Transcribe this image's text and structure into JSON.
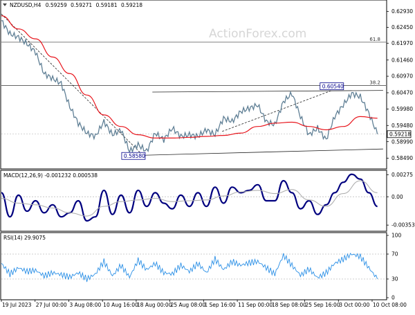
{
  "header": {
    "symbol": "NZDUSD,H4",
    "open": "0.59259",
    "high": "0.59271",
    "low": "0.59181",
    "close": "0.59218"
  },
  "watermark": "ActionForex.com",
  "colors": {
    "price": "#5f7f95",
    "ma": "#e8151c",
    "macd": "#00007f",
    "signal": "#b0b0b0",
    "rsi": "#2a8fe6",
    "level_dotted": "#c0c0c0",
    "label_border": "#00008b"
  },
  "chart_data": [
    {
      "type": "line",
      "panel": "price",
      "title": "NZDUSD,H4",
      "y_ticks": [
        "0.62930",
        "0.62450",
        "0.61970",
        "0.61460",
        "0.60970",
        "0.60470",
        "0.59980",
        "0.59480",
        "0.58990",
        "0.58490"
      ],
      "ylim": [
        0.5825,
        0.6315
      ],
      "x_labels": [
        "19 Jul 2023",
        "27 Jul 00:00",
        "3 Aug 08:00",
        "10 Aug 16:00",
        "18 Aug 00:00",
        "25 Aug 08:00",
        "1 Sep 16:00",
        "11 Sep 00:00",
        "18 Sep 08:00",
        "25 Sep 16:00",
        "3 Oct 00:00",
        "10 Oct 08:00"
      ],
      "series": [
        {
          "name": "",
          "x": [
            0,
            6,
            12,
            18,
            24,
            30,
            36,
            42,
            48,
            54,
            60,
            66,
            72,
            78,
            84,
            90,
            96,
            102,
            108,
            114,
            120,
            126,
            132,
            138,
            144,
            150,
            156,
            162,
            168,
            174,
            180,
            186,
            192,
            198,
            204,
            210,
            216,
            222,
            228,
            234,
            240,
            246,
            252,
            258,
            264
          ],
          "values": [
            0.6265,
            0.6225,
            0.6215,
            0.6195,
            0.617,
            0.6105,
            0.609,
            0.6075,
            0.6005,
            0.5955,
            0.5925,
            0.5915,
            0.596,
            0.592,
            0.5935,
            0.587,
            0.589,
            0.587,
            0.5925,
            0.5905,
            0.594,
            0.5915,
            0.592,
            0.5915,
            0.5935,
            0.592,
            0.597,
            0.596,
            0.599,
            0.6,
            0.601,
            0.596,
            0.595,
            0.602,
            0.6045,
            0.5975,
            0.592,
            0.594,
            0.5905,
            0.5975,
            0.601,
            0.6045,
            0.6035,
            0.5985,
            0.5922
          ]
        },
        {
          "name": "",
          "x": [
            0,
            12,
            24,
            36,
            48,
            60,
            72,
            84,
            96,
            108,
            120,
            132,
            144,
            156,
            168,
            180,
            192,
            204,
            216,
            228,
            240,
            252,
            264
          ],
          "values": [
            0.628,
            0.624,
            0.621,
            0.6155,
            0.6105,
            0.604,
            0.598,
            0.5945,
            0.592,
            0.591,
            0.591,
            0.5912,
            0.5915,
            0.5918,
            0.5925,
            0.5945,
            0.5955,
            0.5958,
            0.5945,
            0.5935,
            0.5945,
            0.5975,
            0.597
          ]
        }
      ],
      "levels": [
        {
          "label": "61.8",
          "value": 0.62
        },
        {
          "label": "38.2",
          "value": 0.6069
        },
        {
          "label": "",
          "value": 0.5922
        }
      ],
      "trendlines": [
        {
          "x": [
            0,
            100
          ],
          "values": [
            0.6285,
            0.5855
          ]
        },
        {
          "x": [
            106,
            268
          ],
          "values": [
            0.6049,
            0.6054
          ]
        },
        {
          "x": [
            100,
            268
          ],
          "values": [
            0.5858,
            0.5877
          ]
        },
        {
          "x": [
            155,
            232
          ],
          "values": [
            0.593,
            0.6054
          ]
        }
      ],
      "annotations": [
        {
          "text": "0.60540",
          "x": 232,
          "value": 0.6054
        },
        {
          "text": "0.58580",
          "x": 100,
          "value": 0.5858
        },
        {
          "text": "0.59218",
          "x": 268,
          "value": 0.59218
        }
      ]
    },
    {
      "type": "line",
      "panel": "macd",
      "title": "MACD(12,26,9) -0.001232 0.000538",
      "y_ticks": [
        "0.00275",
        "0.00",
        "-0.003531"
      ],
      "ylim": [
        -0.00395,
        0.00295
      ],
      "series": [
        {
          "name": "",
          "x": [
            0,
            6,
            12,
            18,
            24,
            30,
            36,
            42,
            48,
            54,
            60,
            66,
            72,
            78,
            84,
            90,
            96,
            102,
            108,
            114,
            120,
            126,
            132,
            138,
            144,
            150,
            156,
            162,
            168,
            174,
            180,
            186,
            192,
            198,
            204,
            210,
            216,
            222,
            228,
            234,
            240,
            246,
            252,
            258,
            264
          ],
          "values": [
            0.0005,
            -0.0025,
            0.0002,
            -0.0018,
            -0.0005,
            -0.002,
            -0.001,
            -0.0025,
            -0.002,
            -0.0005,
            -0.003,
            -0.0025,
            0.0008,
            -0.0022,
            0.0002,
            -0.002,
            0.0008,
            -0.0012,
            0.0005,
            -0.0008,
            -0.0015,
            0.0002,
            -0.0012,
            0.0005,
            -0.0012,
            0.0012,
            -0.0008,
            0.0012,
            0.0005,
            0.0008,
            0.0015,
            -0.0005,
            -0.0005,
            0.002,
            0.0005,
            -0.0015,
            -0.0005,
            -0.0022,
            -0.001,
            0.0005,
            0.0018,
            0.0028,
            0.0022,
            0.0005,
            -0.0012
          ]
        },
        {
          "name": "",
          "x": [
            0,
            12,
            24,
            36,
            48,
            60,
            72,
            84,
            96,
            108,
            120,
            132,
            144,
            156,
            168,
            180,
            192,
            204,
            216,
            228,
            240,
            252,
            264
          ],
          "values": [
            -0.0002,
            -0.0008,
            -0.001,
            -0.0014,
            -0.002,
            -0.0024,
            -0.0012,
            -0.0006,
            -0.0004,
            -0.0002,
            -0.0006,
            -0.0005,
            -0.0004,
            0.0001,
            0.0006,
            0.0008,
            0.0004,
            0.0009,
            -0.0004,
            -0.0012,
            0.0004,
            0.002,
            0.0005
          ]
        }
      ]
    },
    {
      "type": "line",
      "panel": "rsi",
      "title": "RSI(14) 29.9075",
      "y_ticks": [
        "100",
        "70",
        "30",
        "0"
      ],
      "ylim": [
        0,
        100
      ],
      "series": [
        {
          "name": "",
          "x": [
            0,
            6,
            12,
            18,
            24,
            30,
            36,
            42,
            48,
            54,
            60,
            66,
            72,
            78,
            84,
            90,
            96,
            102,
            108,
            114,
            120,
            126,
            132,
            138,
            144,
            150,
            156,
            162,
            168,
            174,
            180,
            186,
            192,
            198,
            204,
            210,
            216,
            222,
            228,
            234,
            240,
            246,
            252,
            258,
            264
          ],
          "values": [
            55,
            38,
            48,
            42,
            44,
            35,
            40,
            37,
            33,
            40,
            30,
            38,
            58,
            35,
            52,
            33,
            60,
            45,
            55,
            40,
            38,
            52,
            42,
            55,
            40,
            62,
            45,
            58,
            52,
            56,
            58,
            48,
            38,
            68,
            52,
            36,
            46,
            32,
            40,
            55,
            62,
            70,
            66,
            48,
            30
          ]
        }
      ],
      "levels": [
        70,
        30
      ]
    }
  ]
}
